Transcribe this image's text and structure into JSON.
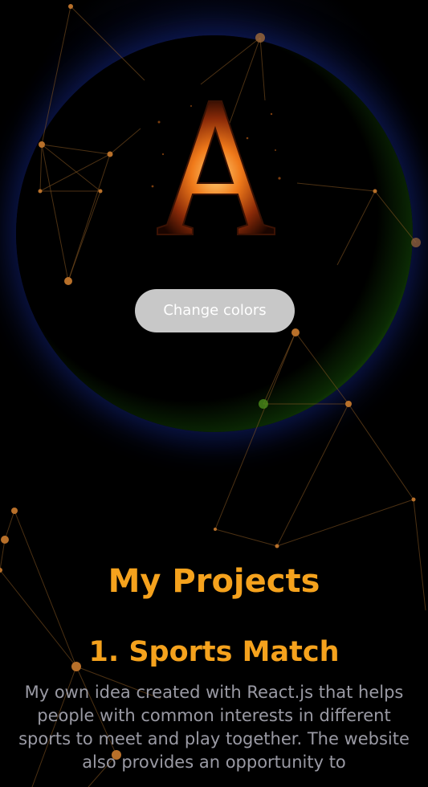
{
  "hero": {
    "logo_icon": "fiery-letter-a-logo",
    "logo_text": "A",
    "change_colors_label": "Change colors",
    "orb_glow_color": "#52c71a",
    "halo_color": "#1e328c"
  },
  "projects": {
    "heading": "My Projects",
    "items": [
      {
        "title": "1. Sports Match",
        "description": "My own idea created with React.js that helps people with common interests in different sports to meet and play together. The website also provides an opportunity to"
      }
    ]
  },
  "colors": {
    "accent": "#f5a21d",
    "body_text": "#9a9aa4",
    "button_bg": "#c8c8c8",
    "network_node": "#b8702a"
  }
}
